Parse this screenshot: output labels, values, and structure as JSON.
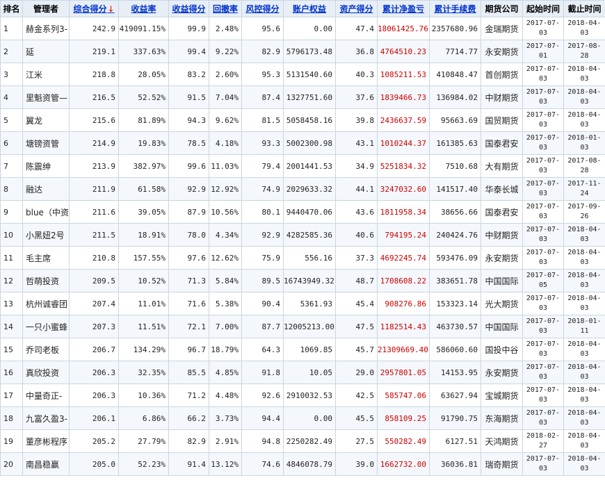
{
  "headers": [
    "排名",
    "管理者",
    "综合得分",
    "收益率",
    "收益得分",
    "回撤率",
    "风控得分",
    "账户权益",
    "资产得分",
    "累计净盈亏",
    "累计手续费",
    "期货公司",
    "起始时间",
    "截止时间"
  ],
  "sort_indicator": "↓",
  "rows": [
    {
      "rank": "1",
      "name": "赫金系列3-",
      "score": "242.9",
      "ret": "419091.15%",
      "ret_score": "99.9",
      "drawdown": "2.48%",
      "risk_score": "95.6",
      "equity": "0.00",
      "asset_score": "47.4",
      "net_pnl": "18061425.76",
      "fees": "2357680.96",
      "company": "金瑞期货",
      "start_y": "2017-07-",
      "start_d": "03",
      "end_y": "2018-04-",
      "end_d": "03"
    },
    {
      "rank": "2",
      "name": "延",
      "score": "219.1",
      "ret": "337.63%",
      "ret_score": "99.4",
      "drawdown": "9.22%",
      "risk_score": "82.9",
      "equity": "5796173.48",
      "asset_score": "36.8",
      "net_pnl": "4764510.23",
      "fees": "7714.77",
      "company": "永安期货",
      "start_y": "2017-07-",
      "start_d": "01",
      "end_y": "2017-08-",
      "end_d": "28"
    },
    {
      "rank": "3",
      "name": "江米",
      "score": "218.8",
      "ret": "28.05%",
      "ret_score": "83.2",
      "drawdown": "2.60%",
      "risk_score": "95.3",
      "equity": "5131540.60",
      "asset_score": "40.3",
      "net_pnl": "1085211.53",
      "fees": "410848.47",
      "company": "首创期货",
      "start_y": "2017-07-",
      "start_d": "03",
      "end_y": "2018-04-",
      "end_d": "03"
    },
    {
      "rank": "4",
      "name": "里魁资管—",
      "score": "216.5",
      "ret": "52.52%",
      "ret_score": "91.5",
      "drawdown": "7.04%",
      "risk_score": "87.4",
      "equity": "1327751.60",
      "asset_score": "37.6",
      "net_pnl": "1839466.73",
      "fees": "136984.02",
      "company": "中财期货",
      "start_y": "2017-07-",
      "start_d": "03",
      "end_y": "2018-04-",
      "end_d": "03"
    },
    {
      "rank": "5",
      "name": "翼龙",
      "score": "215.6",
      "ret": "81.89%",
      "ret_score": "94.3",
      "drawdown": "9.62%",
      "risk_score": "81.5",
      "equity": "5058458.16",
      "asset_score": "39.8",
      "net_pnl": "2436637.59",
      "fees": "95663.69",
      "company": "国贸期货",
      "start_y": "2017-07-",
      "start_d": "03",
      "end_y": "2018-04-",
      "end_d": "03"
    },
    {
      "rank": "6",
      "name": "塘镑资管",
      "score": "214.9",
      "ret": "19.83%",
      "ret_score": "78.5",
      "drawdown": "4.18%",
      "risk_score": "93.3",
      "equity": "5002300.98",
      "asset_score": "43.1",
      "net_pnl": "1010244.37",
      "fees": "161385.63",
      "company": "国泰君安",
      "start_y": "2017-07-",
      "start_d": "03",
      "end_y": "2018-01-",
      "end_d": "03"
    },
    {
      "rank": "7",
      "name": "陈震绅",
      "score": "213.9",
      "ret": "382.97%",
      "ret_score": "99.6",
      "drawdown": "11.03%",
      "risk_score": "79.4",
      "equity": "2001441.53",
      "asset_score": "34.9",
      "net_pnl": "5251834.32",
      "fees": "7510.68",
      "company": "大有期货",
      "start_y": "2017-07-",
      "start_d": "03",
      "end_y": "2017-08-",
      "end_d": "28"
    },
    {
      "rank": "8",
      "name": "融达",
      "score": "211.9",
      "ret": "61.58%",
      "ret_score": "92.9",
      "drawdown": "12.92%",
      "risk_score": "74.9",
      "equity": "2029633.32",
      "asset_score": "44.1",
      "net_pnl": "3247032.60",
      "fees": "141517.40",
      "company": "华泰长城",
      "start_y": "2017-07-",
      "start_d": "03",
      "end_y": "2017-11-",
      "end_d": "24"
    },
    {
      "rank": "9",
      "name": "blue（中资",
      "score": "211.6",
      "ret": "39.05%",
      "ret_score": "87.9",
      "drawdown": "10.56%",
      "risk_score": "80.1",
      "equity": "9440470.06",
      "asset_score": "43.6",
      "net_pnl": "1811958.34",
      "fees": "38656.66",
      "company": "国泰君安",
      "start_y": "2017-07-",
      "start_d": "03",
      "end_y": "2017-09-",
      "end_d": "26"
    },
    {
      "rank": "10",
      "name": "小黑妞2号",
      "score": "211.5",
      "ret": "18.91%",
      "ret_score": "78.0",
      "drawdown": "4.34%",
      "risk_score": "92.9",
      "equity": "4282585.36",
      "asset_score": "40.6",
      "net_pnl": "794195.24",
      "fees": "240424.76",
      "company": "中财期货",
      "start_y": "2017-07-",
      "start_d": "03",
      "end_y": "2018-04-",
      "end_d": "03"
    },
    {
      "rank": "11",
      "name": "毛主席",
      "score": "210.8",
      "ret": "157.55%",
      "ret_score": "97.6",
      "drawdown": "12.62%",
      "risk_score": "75.9",
      "equity": "556.16",
      "asset_score": "37.3",
      "net_pnl": "4692245.74",
      "fees": "593476.09",
      "company": "永安期货",
      "start_y": "2017-07-",
      "start_d": "03",
      "end_y": "2018-04-",
      "end_d": "03"
    },
    {
      "rank": "12",
      "name": "哲萌投资",
      "score": "209.5",
      "ret": "10.52%",
      "ret_score": "71.3",
      "drawdown": "5.84%",
      "risk_score": "89.5",
      "equity": "16743949.32",
      "asset_score": "48.7",
      "net_pnl": "1708608.22",
      "fees": "383651.78",
      "company": "中国国际",
      "start_y": "2017-07-",
      "start_d": "05",
      "end_y": "2018-04-",
      "end_d": "03"
    },
    {
      "rank": "13",
      "name": "杭州诚睿团",
      "score": "207.4",
      "ret": "11.01%",
      "ret_score": "71.6",
      "drawdown": "5.38%",
      "risk_score": "90.4",
      "equity": "5361.93",
      "asset_score": "45.4",
      "net_pnl": "908276.86",
      "fees": "153323.14",
      "company": "光大期货",
      "start_y": "2017-07-",
      "start_d": "03",
      "end_y": "2018-04-",
      "end_d": "03"
    },
    {
      "rank": "14",
      "name": "一只小蜜蜂",
      "score": "207.3",
      "ret": "11.51%",
      "ret_score": "72.1",
      "drawdown": "7.00%",
      "risk_score": "87.7",
      "equity": "12005213.00",
      "asset_score": "47.5",
      "net_pnl": "1182514.43",
      "fees": "463730.57",
      "company": "中国国际",
      "start_y": "2017-07-",
      "start_d": "03",
      "end_y": "2018-01-",
      "end_d": "11"
    },
    {
      "rank": "15",
      "name": "乔司老板",
      "score": "206.7",
      "ret": "134.29%",
      "ret_score": "96.7",
      "drawdown": "18.79%",
      "risk_score": "64.3",
      "equity": "1069.85",
      "asset_score": "45.7",
      "net_pnl": "21309669.40",
      "fees": "586060.60",
      "company": "国投中谷",
      "start_y": "2017-07-",
      "start_d": "03",
      "end_y": "2018-04-",
      "end_d": "03"
    },
    {
      "rank": "16",
      "name": "真欣投资",
      "score": "206.3",
      "ret": "32.35%",
      "ret_score": "85.5",
      "drawdown": "4.85%",
      "risk_score": "91.8",
      "equity": "10.05",
      "asset_score": "29.0",
      "net_pnl": "2957801.05",
      "fees": "14153.95",
      "company": "永安期货",
      "start_y": "2017-07-",
      "start_d": "03",
      "end_y": "2018-04-",
      "end_d": "03"
    },
    {
      "rank": "17",
      "name": "中量奇正-",
      "score": "206.3",
      "ret": "10.36%",
      "ret_score": "71.2",
      "drawdown": "4.48%",
      "risk_score": "92.6",
      "equity": "2910032.53",
      "asset_score": "42.5",
      "net_pnl": "585747.06",
      "fees": "63627.94",
      "company": "宝城期货",
      "start_y": "2017-07-",
      "start_d": "03",
      "end_y": "2018-04-",
      "end_d": "03"
    },
    {
      "rank": "18",
      "name": "九富久盈3-",
      "score": "206.1",
      "ret": "6.86%",
      "ret_score": "66.2",
      "drawdown": "3.73%",
      "risk_score": "94.4",
      "equity": "0.00",
      "asset_score": "45.5",
      "net_pnl": "858109.25",
      "fees": "91790.75",
      "company": "东海期货",
      "start_y": "2017-07-",
      "start_d": "03",
      "end_y": "2018-04-",
      "end_d": "03"
    },
    {
      "rank": "19",
      "name": "董彦彬程序",
      "score": "205.2",
      "ret": "27.79%",
      "ret_score": "82.9",
      "drawdown": "2.91%",
      "risk_score": "94.8",
      "equity": "2250282.49",
      "asset_score": "27.5",
      "net_pnl": "550282.49",
      "fees": "6127.51",
      "company": "天鸿期货",
      "start_y": "2018-02-",
      "start_d": "27",
      "end_y": "2018-04-",
      "end_d": "03"
    },
    {
      "rank": "20",
      "name": "南昌稳赢",
      "score": "205.0",
      "ret": "52.23%",
      "ret_score": "91.4",
      "drawdown": "13.12%",
      "risk_score": "74.6",
      "equity": "4846078.79",
      "asset_score": "39.0",
      "net_pnl": "1662732.00",
      "fees": "36036.81",
      "company": "瑞奇期货",
      "start_y": "2017-07-",
      "start_d": "03",
      "end_y": "2018-04-",
      "end_d": "03"
    }
  ]
}
